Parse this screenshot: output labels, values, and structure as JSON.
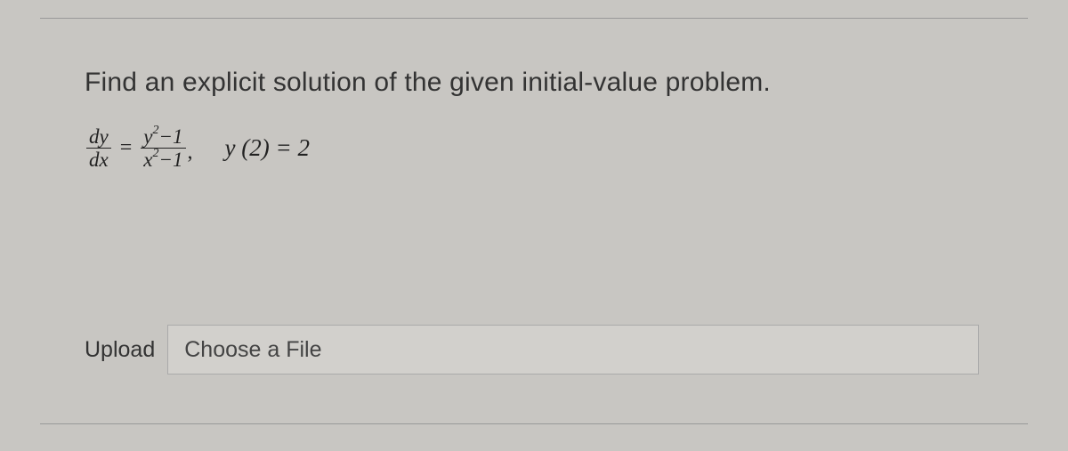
{
  "prompt": "Find an explicit solution of the given initial-value problem.",
  "equation": {
    "lhs": {
      "num": "dy",
      "den": "dx"
    },
    "eq1": "=",
    "rhs": {
      "num_base1": "y",
      "num_sup1": "2",
      "num_tail": "−1",
      "den_base1": "x",
      "den_sup1": "2",
      "den_tail": "−1"
    },
    "comma": ",",
    "condition": "y (2) = 2"
  },
  "upload": {
    "label": "Upload",
    "placeholder": "Choose a File"
  }
}
